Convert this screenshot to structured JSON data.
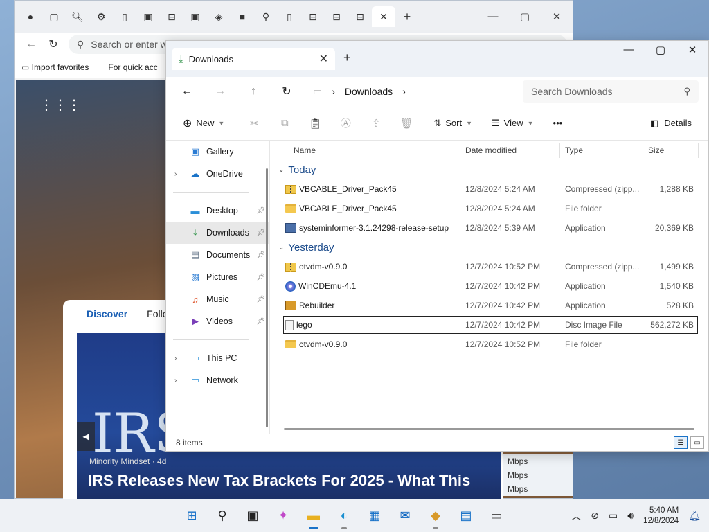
{
  "browser": {
    "tab_icons": [
      "profile-icon",
      "tab-actions-icon",
      "search-icon",
      "settings-icon",
      "page-icon",
      "vb-icon",
      "tab-group-icon",
      "vb-icon",
      "copilot-icon",
      "terminal-icon",
      "search-icon",
      "page-icon",
      "tab-group-icon",
      "tab-group-icon",
      "tab-group-icon"
    ],
    "address_placeholder": "Search or enter web address",
    "favorites": [
      "Import favorites",
      "For quick acc"
    ],
    "card_tabs": [
      "Discover",
      "Follow"
    ],
    "news_big_text": "IRS",
    "news_source": "Minority Mindset · 4d",
    "news_headline": "IRS Releases New Tax Brackets For 2025 - What This",
    "side_col": [
      "Mbps",
      "Mbps",
      "Mbps"
    ]
  },
  "explorer": {
    "tab_title": "Downloads",
    "path": "Downloads",
    "search_placeholder": "Search Downloads",
    "toolbar": {
      "new_label": "New",
      "sort_label": "Sort",
      "view_label": "View",
      "more_label": "•••",
      "details_label": "Details"
    },
    "nav": {
      "top": [
        {
          "label": "Gallery",
          "icon": "gallery-icon"
        },
        {
          "label": "OneDrive",
          "icon": "cloud-icon",
          "expandable": true
        }
      ],
      "pinned": [
        {
          "label": "Desktop",
          "icon": "desktop-icon"
        },
        {
          "label": "Downloads",
          "icon": "download-icon",
          "selected": true
        },
        {
          "label": "Documents",
          "icon": "documents-icon"
        },
        {
          "label": "Pictures",
          "icon": "pictures-icon"
        },
        {
          "label": "Music",
          "icon": "music-icon"
        },
        {
          "label": "Videos",
          "icon": "videos-icon"
        }
      ],
      "bottom": [
        {
          "label": "This PC",
          "icon": "pc-icon"
        },
        {
          "label": "Network",
          "icon": "network-icon"
        }
      ]
    },
    "columns": [
      "Name",
      "Date modified",
      "Type",
      "Size"
    ],
    "groups": [
      {
        "label": "Today",
        "items": [
          {
            "name": "VBCABLE_Driver_Pack45",
            "date": "12/8/2024 5:24 AM",
            "type": "Compressed (zipp...",
            "size": "1,288 KB",
            "icon": "zip"
          },
          {
            "name": "VBCABLE_Driver_Pack45",
            "date": "12/8/2024 5:24 AM",
            "type": "File folder",
            "size": "",
            "icon": "folder"
          },
          {
            "name": "systeminformer-3.1.24298-release-setup",
            "date": "12/8/2024 5:39 AM",
            "type": "Application",
            "size": "20,369 KB",
            "icon": "app"
          }
        ]
      },
      {
        "label": "Yesterday",
        "items": [
          {
            "name": "otvdm-v0.9.0",
            "date": "12/7/2024 10:52 PM",
            "type": "Compressed (zipp...",
            "size": "1,499 KB",
            "icon": "zip"
          },
          {
            "name": "WinCDEmu-4.1",
            "date": "12/7/2024 10:42 PM",
            "type": "Application",
            "size": "1,540 KB",
            "icon": "cd"
          },
          {
            "name": "Rebuilder",
            "date": "12/7/2024 10:42 PM",
            "type": "Application",
            "size": "528 KB",
            "icon": "rb"
          },
          {
            "name": "lego",
            "date": "12/7/2024 10:42 PM",
            "type": "Disc Image File",
            "size": "562,272 KB",
            "icon": "disc",
            "focused": true
          },
          {
            "name": "otvdm-v0.9.0",
            "date": "12/7/2024 10:52 PM",
            "type": "File folder",
            "size": "",
            "icon": "folder"
          }
        ]
      }
    ],
    "status": "8 items"
  },
  "taskbar": {
    "apps": [
      {
        "icon": "start-icon",
        "glyph": "⊞"
      },
      {
        "icon": "search-icon",
        "glyph": "⚲"
      },
      {
        "icon": "task-view-icon",
        "glyph": "▣"
      },
      {
        "icon": "copilot-icon",
        "glyph": "✦"
      },
      {
        "icon": "file-explorer-icon",
        "glyph": "▬",
        "active": true
      },
      {
        "icon": "edge-icon",
        "glyph": "◐",
        "running": true
      },
      {
        "icon": "store-icon",
        "glyph": "▦"
      },
      {
        "icon": "outlook-icon",
        "glyph": "✉"
      },
      {
        "icon": "app-icon",
        "glyph": "◆",
        "running": true
      },
      {
        "icon": "monitor-icon",
        "glyph": "▤"
      },
      {
        "icon": "drive-icon",
        "glyph": "▭"
      }
    ],
    "time": "5:40 AM",
    "date": "12/8/2024"
  }
}
